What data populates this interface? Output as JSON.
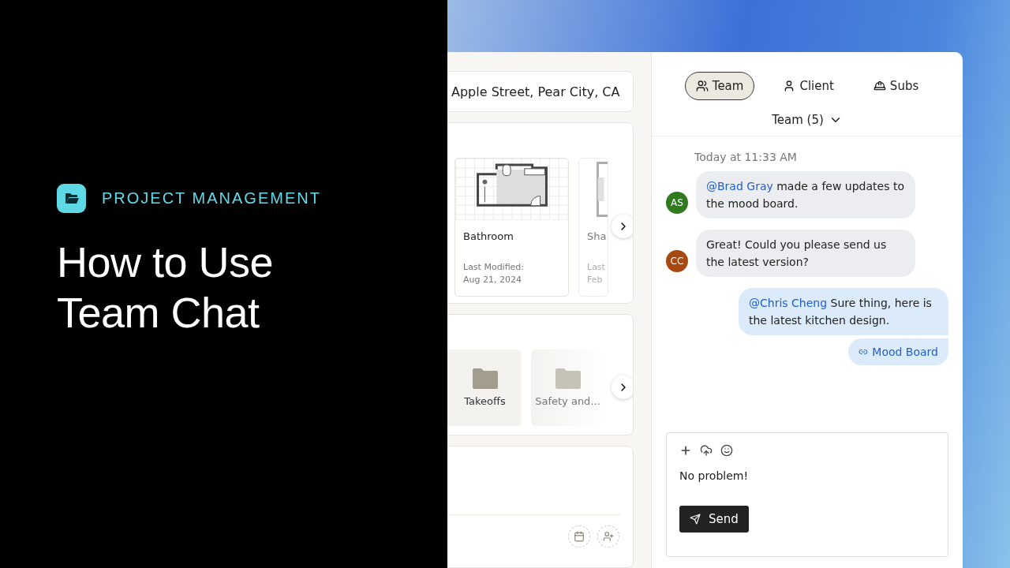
{
  "brand": {
    "category": "PROJECT MANAGEMENT",
    "title_lines": [
      "How to Use",
      "Team Chat"
    ]
  },
  "project": {
    "address": "Apple Street, Pear City, CA"
  },
  "drawings": [
    {
      "title": "Bathroom",
      "modified_label": "Last Modified:",
      "date": "Aug 21, 2024",
      "faded": false
    },
    {
      "title": "Sha",
      "modified_label": "Last",
      "date": "Feb",
      "faded": true
    }
  ],
  "folders": [
    {
      "name": "Takeoffs",
      "faded": false
    },
    {
      "name": "Safety and...",
      "faded": true
    }
  ],
  "chat": {
    "tabs": [
      {
        "label": "Team",
        "selected": true
      },
      {
        "label": "Client",
        "selected": false
      },
      {
        "label": "Subs",
        "selected": false
      }
    ],
    "group": "Team (5)",
    "timestamp": "Today at 11:33 AM",
    "messages": [
      {
        "kind": "incoming",
        "initials": "AS",
        "color": "#2f7a1c",
        "mention": "@Brad Gray",
        "text": "made a few updates to the mood board."
      },
      {
        "kind": "incoming",
        "initials": "CC",
        "color": "#a84a10",
        "text": "Great! Could you please send us the latest version?"
      },
      {
        "kind": "outgoing",
        "mention": "@Chris Cheng",
        "text": "Sure thing, here is the latest kitchen design."
      },
      {
        "kind": "link",
        "text": "Mood Board"
      }
    ],
    "composer": {
      "value": "No problem!",
      "send": "Send"
    }
  }
}
